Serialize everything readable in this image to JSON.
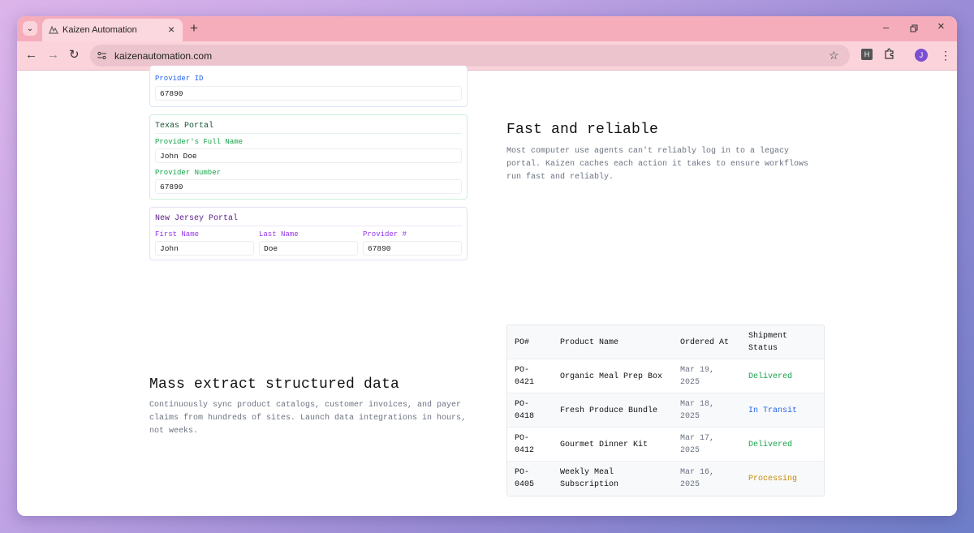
{
  "browser": {
    "tab_title": "Kaizen Automation",
    "url": "kaizenautomation.com",
    "ext_badge": "H",
    "avatar_letter": "J"
  },
  "cards": {
    "top_card": {
      "field_label": "Provider ID",
      "field_value": "67890",
      "accent": "#2563eb"
    },
    "texas": {
      "title": "Texas Portal",
      "label_name": "Provider's Full Name",
      "value_name": "John Doe",
      "label_number": "Provider Number",
      "value_number": "67890",
      "accent": "#16a34a"
    },
    "new_jersey": {
      "title": "New Jersey Portal",
      "label_first": "First Name",
      "value_first": "John",
      "label_last": "Last Name",
      "value_last": "Doe",
      "label_provider": "Provider #",
      "value_provider": "67890",
      "accent": "#9333ea"
    }
  },
  "fast": {
    "heading": "Fast and reliable",
    "body": "Most computer use agents can't reliably log in to a legacy portal. Kaizen caches each action it takes to ensure workflows run fast and reliably."
  },
  "extract": {
    "heading": "Mass extract structured data",
    "body": "Continuously sync product catalogs, customer invoices, and payer claims from hundreds of sites. Launch data integrations in hours, not weeks."
  },
  "orders": {
    "headers": [
      "PO#",
      "Product Name",
      "Ordered At",
      "Shipment Status"
    ],
    "rows": [
      {
        "po": "PO-0421",
        "product": "Organic Meal Prep Box",
        "ordered": "Mar 19, 2025",
        "status": "Delivered",
        "status_color": "#16a34a"
      },
      {
        "po": "PO-0418",
        "product": "Fresh Produce Bundle",
        "ordered": "Mar 18, 2025",
        "status": "In Transit",
        "status_color": "#2563eb"
      },
      {
        "po": "PO-0412",
        "product": "Gourmet Dinner Kit",
        "ordered": "Mar 17, 2025",
        "status": "Delivered",
        "status_color": "#16a34a"
      },
      {
        "po": "PO-0405",
        "product": "Weekly Meal Subscription",
        "ordered": "Mar 16, 2025",
        "status": "Processing",
        "status_color": "#ca8a04"
      }
    ]
  }
}
